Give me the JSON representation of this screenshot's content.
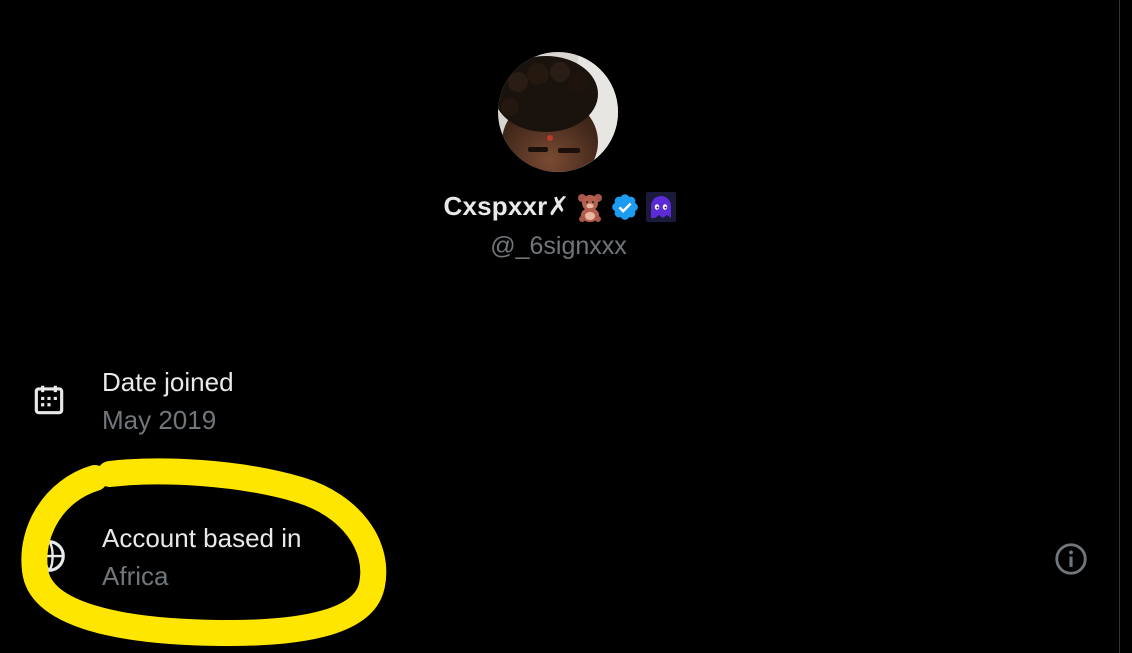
{
  "profile": {
    "display_name": "Cxspxxr✗",
    "handle": "@_6signxxx",
    "name_emojis": [
      "teddy-bear-icon",
      "verified-badge-icon",
      "purple-ghost-icon"
    ],
    "verified_color": "#1d9bf0"
  },
  "details": {
    "date_joined": {
      "icon": "calendar-icon",
      "label": "Date joined",
      "value": "May 2019"
    },
    "account_location": {
      "icon": "globe-icon",
      "label": "Account based in",
      "value": "Africa",
      "action_icon": "info-icon"
    }
  },
  "annotation": {
    "shape": "hand-drawn circle around account location",
    "color": "#ffe600"
  },
  "colors": {
    "background": "#000000",
    "primary_text": "#e7e9ea",
    "secondary_text": "#71767b"
  }
}
